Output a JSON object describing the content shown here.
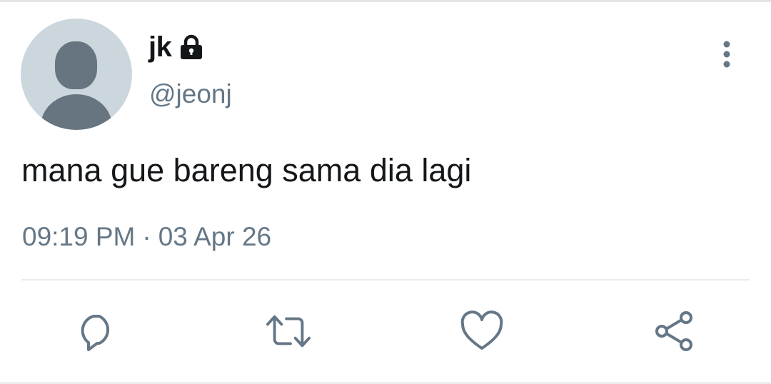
{
  "tweet": {
    "author": {
      "display_name": "jk",
      "handle": "@jeonj",
      "protected_icon": "lock-icon",
      "avatar_icon": "default-avatar"
    },
    "text": "mana gue bareng sama dia lagi",
    "time": "09:19 PM",
    "separator": "·",
    "date": "03 Apr 26"
  },
  "actions": [
    {
      "name": "reply",
      "icon": "reply-icon"
    },
    {
      "name": "retweet",
      "icon": "retweet-icon"
    },
    {
      "name": "like",
      "icon": "heart-icon"
    },
    {
      "name": "share",
      "icon": "share-icon"
    }
  ],
  "menu": {
    "icon": "more-vertical-icon"
  },
  "colors": {
    "text_primary": "#14171a",
    "text_secondary": "#657786",
    "avatar_bg": "#ccd6dd",
    "avatar_fg": "#66757f",
    "divider": "#e6ecf0"
  }
}
